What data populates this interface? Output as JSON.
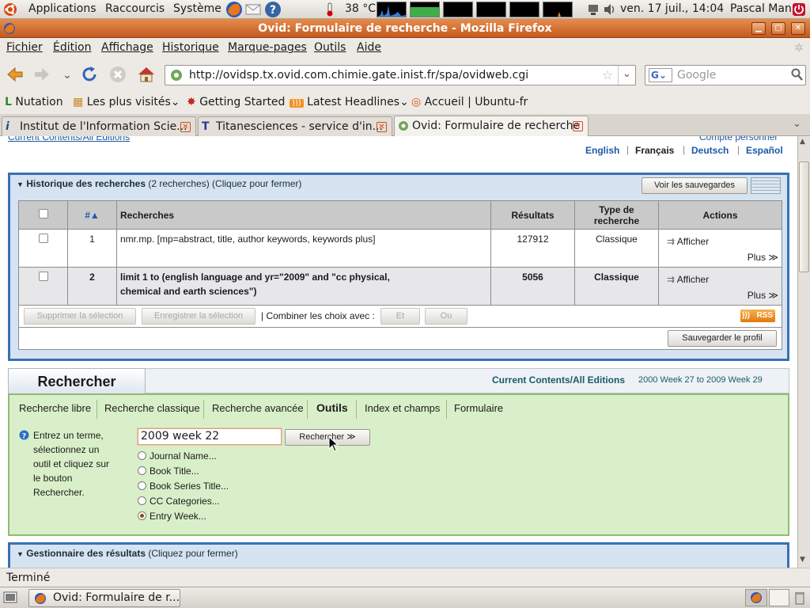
{
  "top_panel": {
    "applications": "Applications",
    "shortcuts": "Raccourcis",
    "system": "Système",
    "temperature": "38 °C",
    "datetime": "ven. 17 juil., 14:04",
    "user": "Pascal Man"
  },
  "window": {
    "title": "Ovid: Formulaire de recherche - Mozilla Firefox"
  },
  "menu": {
    "file": "Fichier",
    "edit": "Édition",
    "view": "Affichage",
    "history": "Historique",
    "bookmarks": "Marque-pages",
    "tools": "Outils",
    "help": "Aide"
  },
  "nav": {
    "url": "http://ovidsp.tx.ovid.com.chimie.gate.inist.fr/spa/ovidweb.cgi",
    "search_placeholder": "Google"
  },
  "bookmarks": {
    "items": [
      "Nutation",
      "Les plus visités",
      "Getting Started",
      "Latest Headlines",
      "Accueil | Ubuntu-fr"
    ]
  },
  "tabs": {
    "items": [
      "Institut de l'Information Scie...",
      "Titanesciences - service d'in...",
      "Ovid: Formulaire de recherche"
    ]
  },
  "page": {
    "top_link_partial": "Current Contents/All Editions",
    "account_link_partial": "Compte personnel",
    "languages": [
      "English",
      "Français",
      "Deutsch",
      "Español"
    ],
    "history": {
      "title": "Historique des recherches",
      "count_note": "(2 recherches) (Cliquez pour fermer)",
      "view_saved": "Voir les sauvegardes",
      "columns": {
        "num": "#",
        "searches": "Recherches",
        "results": "Résultats",
        "type": "Type de recherche",
        "actions": "Actions"
      },
      "rows": [
        {
          "num": "1",
          "query": "nmr.mp. [mp=abstract, title, author keywords, keywords plus]",
          "results": "127912",
          "type": "Classique",
          "display": "Afficher",
          "more": "Plus ≫"
        },
        {
          "num": "2",
          "query": "limit 1 to (english language and yr=\"2009\" and \"cc physical, chemical and earth sciences\")",
          "results": "5056",
          "type": "Classique",
          "display": "Afficher",
          "more": "Plus ≫"
        }
      ],
      "delete_selection": "Supprimer la sélection",
      "save_selection": "Enregistrer la sélection",
      "combine_label": "| Combiner les choix avec :",
      "and": "Et",
      "or": "Ou",
      "rss": "RSS",
      "save_profile": "Sauvegarder le profil"
    },
    "search": {
      "title": "Rechercher",
      "database": "Current Contents/All Editions",
      "range": "2000 Week 27 to 2009 Week 29",
      "tabs": [
        "Recherche libre",
        "Recherche classique",
        "Recherche avancée",
        "Outils",
        "Index et champs",
        "Formulaire"
      ],
      "instructions": [
        "Entrez un terme,",
        "sélectionnez un",
        "outil et cliquez sur",
        "le bouton",
        "Rechercher."
      ],
      "term_value": "2009 week 22",
      "search_button": "Rechercher ≫",
      "options": [
        "Journal Name...",
        "Book Title...",
        "Book Series Title...",
        "CC Categories...",
        "Entry Week..."
      ],
      "selected_option": "Entry Week..."
    },
    "results_manager": {
      "title": "Gestionnaire des résultats",
      "note": "(Cliquez pour fermer)"
    }
  },
  "status": {
    "text": "Terminé"
  },
  "taskbar": {
    "window_button": "Ovid: Formulaire de r..."
  }
}
